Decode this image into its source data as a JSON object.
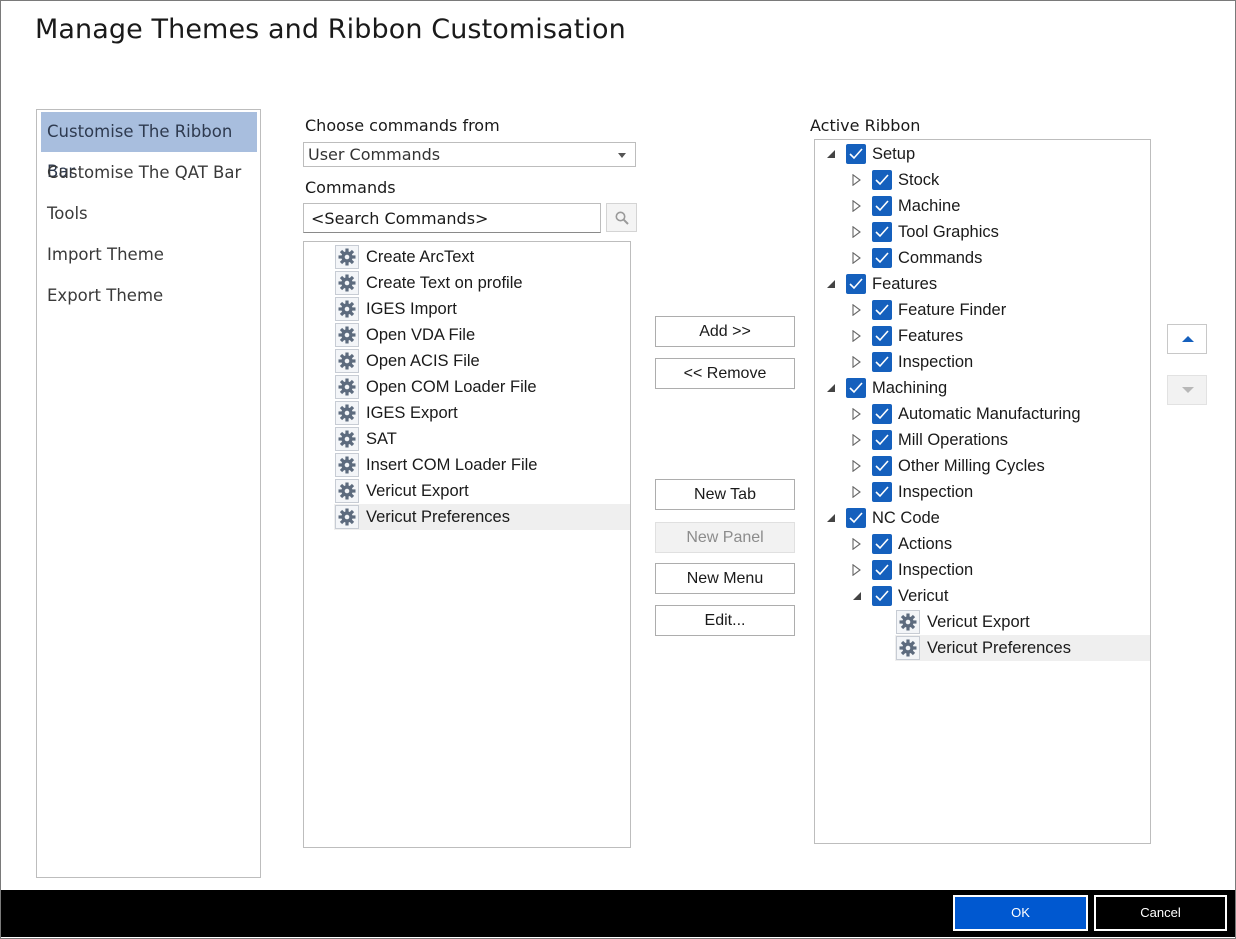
{
  "window": {
    "title": "Manage Themes and Ribbon Customisation"
  },
  "nav": {
    "items": [
      {
        "label": "Customise The Ribbon Bar",
        "selected": true
      },
      {
        "label": "Customise The QAT Bar"
      },
      {
        "label": "Tools"
      },
      {
        "label": "Import Theme"
      },
      {
        "label": "Export Theme"
      }
    ]
  },
  "commands_panel": {
    "choose_label": "Choose commands from",
    "source_value": "User Commands",
    "commands_label": "Commands",
    "search_value": "<Search Commands>",
    "items": [
      {
        "label": "Create ArcText",
        "icon": "gear-icon"
      },
      {
        "label": "Create Text on profile",
        "icon": "gear-icon"
      },
      {
        "label": "IGES Import",
        "icon": "gear-icon"
      },
      {
        "label": "Open VDA File",
        "icon": "gear-icon"
      },
      {
        "label": "Open ACIS File",
        "icon": "gear-icon"
      },
      {
        "label": "Open COM Loader File",
        "icon": "gear-icon"
      },
      {
        "label": "IGES Export",
        "icon": "gear-icon"
      },
      {
        "label": "SAT",
        "icon": "gear-icon"
      },
      {
        "label": "Insert COM Loader File",
        "icon": "gear-icon"
      },
      {
        "label": "Vericut Export",
        "icon": "gear-icon"
      },
      {
        "label": "Vericut Preferences",
        "icon": "gear-icon",
        "selected": true
      }
    ]
  },
  "actions": {
    "add": "Add >>",
    "remove": "<< Remove",
    "new_tab": "New Tab",
    "new_panel": "New Panel",
    "new_menu": "New Menu",
    "edit": "Edit..."
  },
  "ribbon": {
    "label": "Active Ribbon",
    "tree": [
      {
        "label": "Setup",
        "level": 0,
        "expanded": true,
        "checked": true
      },
      {
        "label": "Stock",
        "level": 1,
        "expanded": false,
        "checked": true
      },
      {
        "label": "Machine",
        "level": 1,
        "expanded": false,
        "checked": true
      },
      {
        "label": "Tool Graphics",
        "level": 1,
        "expanded": false,
        "checked": true
      },
      {
        "label": "Commands",
        "level": 1,
        "expanded": false,
        "checked": true
      },
      {
        "label": "Features",
        "level": 0,
        "expanded": true,
        "checked": true
      },
      {
        "label": "Feature Finder",
        "level": 1,
        "expanded": false,
        "checked": true
      },
      {
        "label": "Features",
        "level": 1,
        "expanded": false,
        "checked": true
      },
      {
        "label": "Inspection",
        "level": 1,
        "expanded": false,
        "checked": true
      },
      {
        "label": "Machining",
        "level": 0,
        "expanded": true,
        "checked": true
      },
      {
        "label": "Automatic Manufacturing",
        "level": 1,
        "expanded": false,
        "checked": true
      },
      {
        "label": "Mill Operations",
        "level": 1,
        "expanded": false,
        "checked": true
      },
      {
        "label": "Other Milling Cycles",
        "level": 1,
        "expanded": false,
        "checked": true
      },
      {
        "label": "Inspection",
        "level": 1,
        "expanded": false,
        "checked": true
      },
      {
        "label": "NC Code",
        "level": 0,
        "expanded": true,
        "checked": true
      },
      {
        "label": "Actions",
        "level": 1,
        "expanded": false,
        "checked": true
      },
      {
        "label": "Inspection",
        "level": 1,
        "expanded": false,
        "checked": true
      },
      {
        "label": "Vericut",
        "level": 1,
        "expanded": true,
        "checked": true
      },
      {
        "label": "Vericut Export",
        "level": 2,
        "command": true,
        "icon": "gear-icon"
      },
      {
        "label": "Vericut Preferences",
        "level": 2,
        "command": true,
        "icon": "gear-icon",
        "selected": true
      }
    ]
  },
  "footer": {
    "ok": "OK",
    "cancel": "Cancel"
  },
  "colors": {
    "accent": "#0058d0",
    "checkbox": "#1560bd",
    "nav_selected": "#a8bede"
  }
}
